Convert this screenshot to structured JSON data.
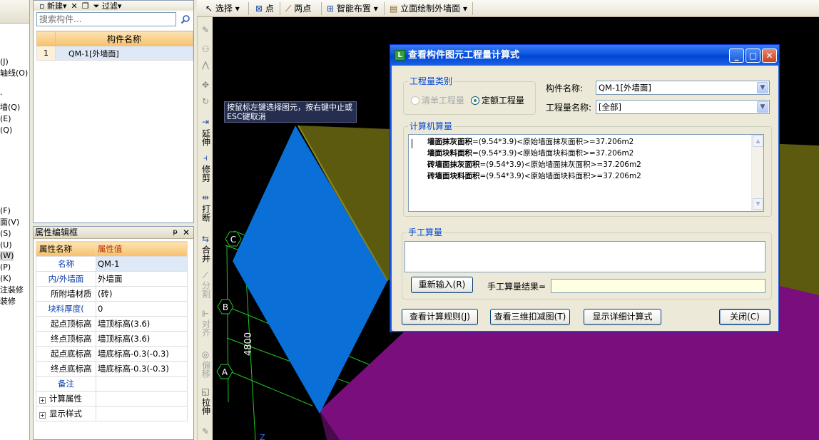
{
  "left_tree": {
    "items": [
      "(J)",
      "轴线(O)",
      "墙(Q)",
      "(E)",
      "(Q)",
      "(F)",
      "面(V)",
      "(S)",
      "(U)",
      "(W)",
      "(P)",
      "(K)",
      "注装修",
      "装修"
    ]
  },
  "component_panel": {
    "toolbar": {
      "new_label": "新建",
      "filter_label": "过滤"
    },
    "search_placeholder": "搜索构件...",
    "column_header": "构件名称",
    "rows": [
      {
        "num": "1",
        "name": "QM-1[外墙面]"
      }
    ]
  },
  "property_panel": {
    "title": "属性编辑框",
    "header": {
      "name": "属性名称",
      "value": "属性值"
    },
    "rows": [
      {
        "name": "名称",
        "value": "QM-1"
      },
      {
        "name": "内/外墙面",
        "value": "外墙面"
      },
      {
        "name": "所附墙材质",
        "value": "(砖)"
      },
      {
        "name": "块料厚度(",
        "value": "0"
      },
      {
        "name": "起点顶标高",
        "value": "墙顶标高(3.6)"
      },
      {
        "name": "终点顶标高",
        "value": "墙顶标高(3.6)"
      },
      {
        "name": "起点底标高",
        "value": "墙底标高-0.3(-0.3)"
      },
      {
        "name": "终点底标高",
        "value": "墙底标高-0.3(-0.3)"
      },
      {
        "name": "备注",
        "value": ""
      },
      {
        "name": "计算属性",
        "value": ""
      },
      {
        "name": "显示样式",
        "value": ""
      }
    ]
  },
  "top_toolbar": {
    "select_label": "选择",
    "point_label": "点",
    "two_points_label": "两点",
    "smart_layout_label": "智能布置",
    "elevation_draw_label": "立面绘制外墙面"
  },
  "vertical_toolbar": {
    "extend": "延伸",
    "trim": "修剪",
    "break": "打断",
    "merge": "合并",
    "split": "分割",
    "align": "对齐",
    "offset": "偏移",
    "stretch": "拉伸"
  },
  "canvas": {
    "tooltip": "按鼠标左键选择图元，按右键中止或ESC键取消",
    "axis_labels": [
      "C",
      "B",
      "A"
    ],
    "dimension_label": "4800",
    "colors": {
      "blue_face": "#0a6fd6",
      "olive_face": "#5c5a0e",
      "purple_face": "#7a0e7c",
      "grid": "#22c722"
    }
  },
  "dialog": {
    "title": "查看构件图元工程量计算式",
    "quantity_type": {
      "group_label": "工程量类别",
      "option_list": "清单工程量",
      "option_quota": "定额工程量"
    },
    "component_name_label": "构件名称:",
    "component_name_value": "QM-1[外墙面]",
    "quantity_name_label": "工程量名称:",
    "quantity_name_value": "[全部]",
    "computer_calc": {
      "group_label": "计算机算量",
      "lines": [
        {
          "name": "墙面抹灰面积",
          "formula": "=(9.54*3.9)<原始墙面抹灰面积>=37.206m2"
        },
        {
          "name": "墙面块料面积",
          "formula": "=(9.54*3.9)<原始墙面块料面积>=37.206m2"
        },
        {
          "name": "砖墙面抹灰面积",
          "formula": "=(9.54*3.9)<原始墙面抹灰面积>=37.206m2"
        },
        {
          "name": "砖墙面块料面积",
          "formula": "=(9.54*3.9)<原始墙面块料面积>=37.206m2"
        }
      ]
    },
    "manual_calc": {
      "group_label": "手工算量",
      "reenter_button": "重新输入(R)",
      "result_label": "手工算量结果="
    },
    "buttons": {
      "view_rules": "查看计算规则(J)",
      "view_3d": "查看三维扣减图(T)",
      "show_detail": "显示详细计算式",
      "close": "关闭(C)"
    }
  }
}
